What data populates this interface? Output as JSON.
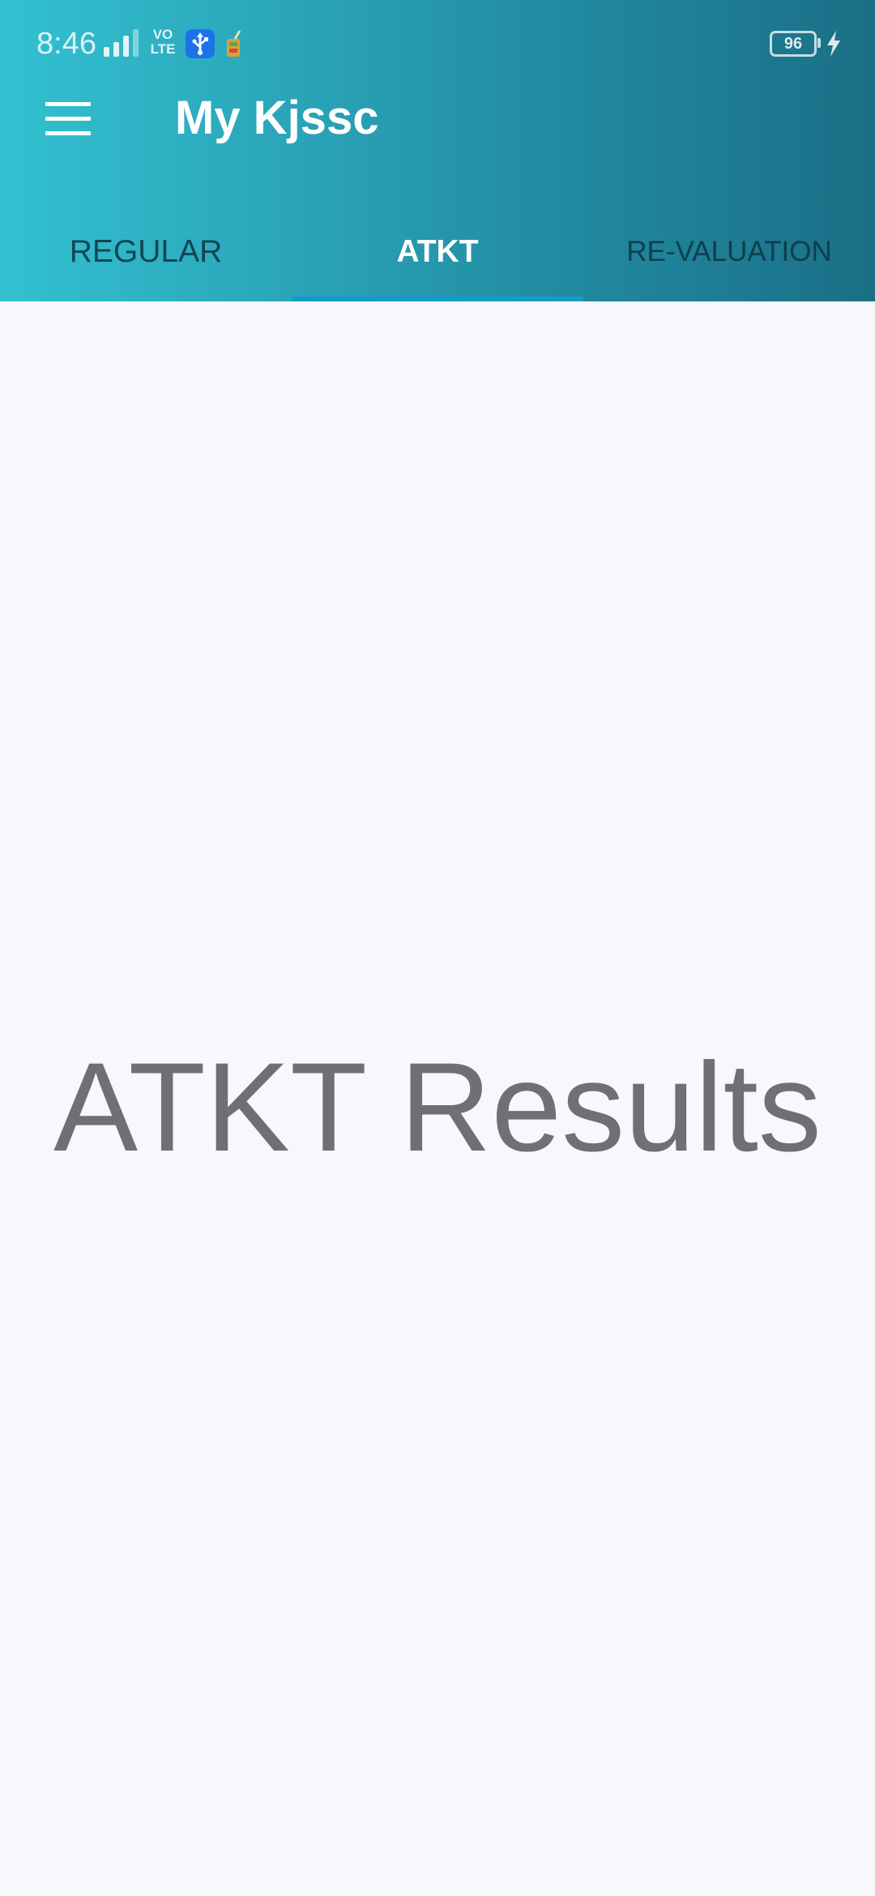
{
  "status_bar": {
    "time": "8:46",
    "network_label": "VO LTE",
    "battery_level": "96",
    "icons": [
      "signal-icon",
      "volte-icon",
      "usb-icon",
      "app-notification-icon",
      "battery-icon",
      "charging-icon"
    ]
  },
  "app_bar": {
    "title": "My Kjssc",
    "menu_icon": "hamburger-menu-icon"
  },
  "tabs": [
    {
      "label": "REGULAR",
      "selected": false
    },
    {
      "label": "ATKT",
      "selected": true
    },
    {
      "label": "RE-VALUATION",
      "selected": false
    }
  ],
  "main": {
    "heading": "ATKT Results"
  },
  "colors": {
    "header_gradient_start": "#32c1d1",
    "header_gradient_end": "#1a6f86",
    "tab_indicator": "#159bc9",
    "background": "#f7f8fc",
    "heading_text": "#707074"
  }
}
